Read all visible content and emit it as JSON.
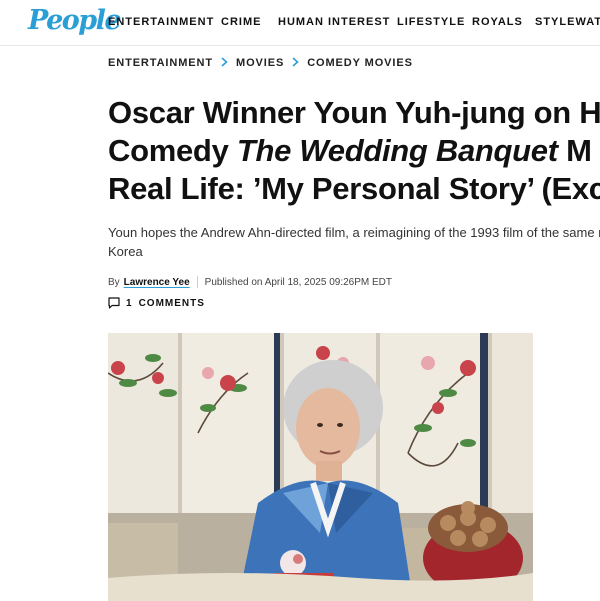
{
  "site": {
    "logo": "People"
  },
  "nav": {
    "items": [
      "ENTERTAINMENT",
      "CRIME",
      "HUMAN INTEREST",
      "LIFESTYLE",
      "ROYALS",
      "STYLEWATCH"
    ]
  },
  "breadcrumb": {
    "items": [
      "ENTERTAINMENT",
      "MOVIES",
      "COMEDY MOVIES"
    ]
  },
  "article": {
    "headline_line1": "Oscar Winner Youn Yuh-jung on H",
    "headline_line2_prefix": "Comedy ",
    "headline_line2_italic": "The Wedding Banquet",
    "headline_line2_suffix": " M",
    "headline_line3": "Real Life: ’My Personal Story’ (Exc",
    "dek_line1": "Youn hopes the Andrew Ahn-directed film, a reimagining of the 1993 film of the same n",
    "dek_line2": "Korea",
    "byline_prefix": "By",
    "author": "Lawrence Yee",
    "published": "Published on April 18, 2025 09:26PM EDT",
    "comments_count": "1",
    "comments_label": "COMMENTS"
  },
  "icons": {
    "comment": "comment-bubble-icon",
    "breadcrumb_separator": "chevron-right-icon"
  },
  "colors": {
    "brand_blue": "#2a9fd6",
    "text": "#111111"
  }
}
